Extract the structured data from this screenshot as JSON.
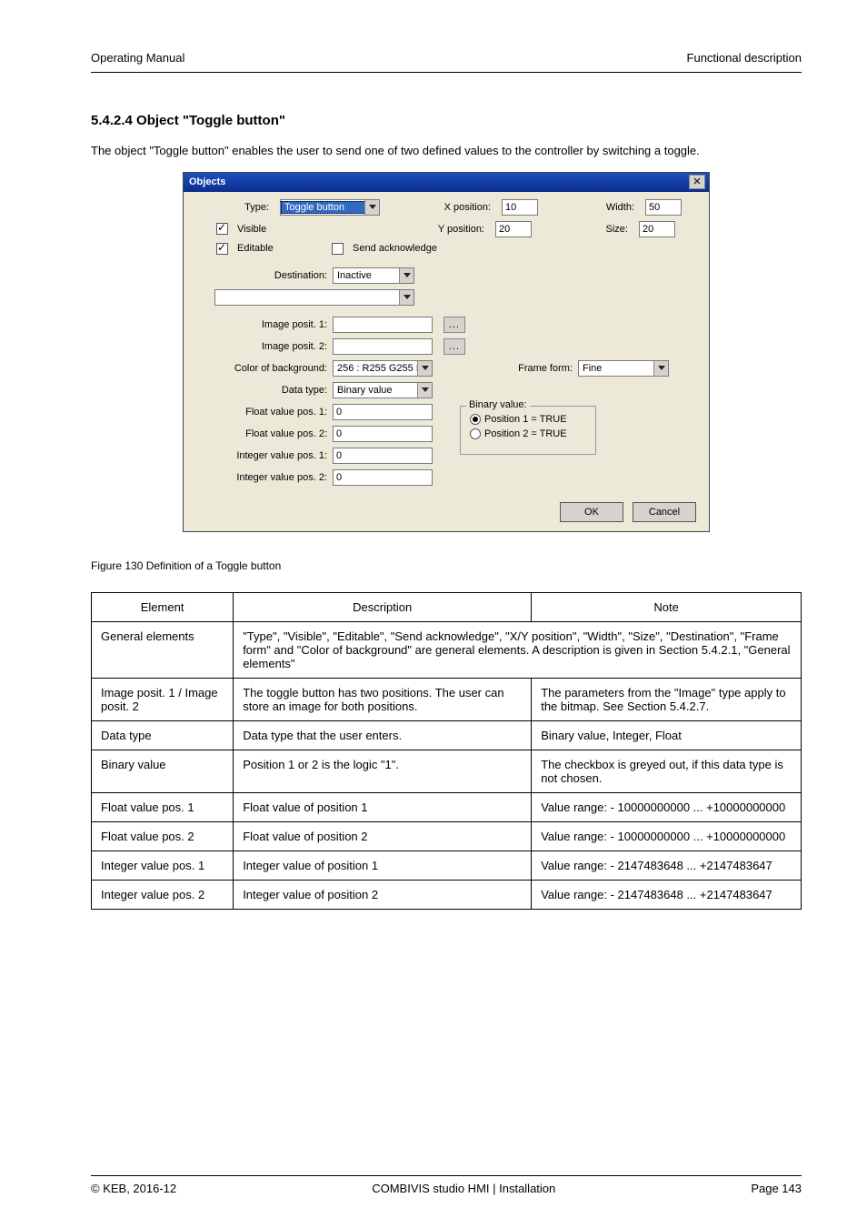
{
  "header": {
    "left": "Operating Manual",
    "right": "Functional description"
  },
  "section_title": "5.4.2.4 Object \"Toggle button\"",
  "intro_text": "The object \"Toggle button\" enables the user to send one of two defined values to the controller by switching a toggle.",
  "dialog": {
    "title": "Objects",
    "type_label": "Type:",
    "type_value": "Toggle button",
    "xpos_label": "X position:",
    "xpos_value": "10",
    "ypos_label": "Y position:",
    "ypos_value": "20",
    "width_label": "Width:",
    "width_value": "50",
    "size_label": "Size:",
    "size_value": "20",
    "visible_label": "Visible",
    "editable_label": "Editable",
    "sendack_label": "Send acknowledge",
    "destination_label": "Destination:",
    "destination_value": "Inactive",
    "img1_label": "Image posit. 1:",
    "img2_label": "Image posit. 2:",
    "browse_btn": "...",
    "bg_label": "Color of background:",
    "bg_value": "256 : R255 G255 B255",
    "frame_label": "Frame form:",
    "frame_value": "Fine",
    "dtype_label": "Data type:",
    "dtype_value": "Binary value",
    "fv1_label": "Float value pos. 1:",
    "fv1_value": "0",
    "fv2_label": "Float value pos. 2:",
    "fv2_value": "0",
    "iv1_label": "Integer value pos. 1:",
    "iv1_value": "0",
    "iv2_label": "Integer value pos. 2:",
    "iv2_value": "0",
    "bin_legend": "Binary value:",
    "bin_opt1": "Position 1 = TRUE",
    "bin_opt2": "Position 2 = TRUE",
    "ok_label": "OK",
    "cancel_label": "Cancel"
  },
  "figure_label": "Figure 130 Definition of a Toggle button",
  "table": {
    "h1": "Element",
    "h2": "Description",
    "h3": "Note",
    "rows": [
      {
        "c1": "General elements",
        "c2": "\"Type\", \"Visible\", \"Editable\", \"Send acknowledge\", \"X/Y position\", \"Width\", \"Size\", \"Destination\", \"Frame form\" and \"Color of background\" are general elements. A description is given in Section 5.4.2.1, \"General elements\"",
        "span": true
      },
      {
        "c1": "Image posit. 1 / Image posit. 2",
        "c2": "The toggle button has two positions. The user can store an image for both positions.",
        "c3": "The parameters from the \"Image\" type apply to the bitmap. See Section 5.4.2.7."
      },
      {
        "c1": "Data type",
        "c2": "Data type that the user enters.",
        "c3": "Binary value, Integer, Float"
      },
      {
        "c1": "Binary value",
        "c2": "Position 1 or 2 is the logic \"1\".",
        "c3": "The checkbox is greyed out, if this data type is not chosen."
      },
      {
        "c1": "Float value pos. 1",
        "c2": "Float value of position 1",
        "c3": "Value range: - 10000000000 ... +10000000000"
      },
      {
        "c1": "Float value pos. 2",
        "c2": "Float value of position 2",
        "c3": "Value range: - 10000000000 ... +10000000000"
      },
      {
        "c1": "Integer value pos. 1",
        "c2": "Integer value of position 1",
        "c3": "Value range: - 2147483648 ... +2147483647"
      },
      {
        "c1": "Integer value pos. 2",
        "c2": "Integer value of position 2",
        "c3": "Value range: - 2147483648 ... +2147483647"
      }
    ]
  },
  "footer": {
    "left": "© KEB, 2016-12",
    "center": "COMBIVIS studio HMI | Installation",
    "right": "Page 143"
  }
}
